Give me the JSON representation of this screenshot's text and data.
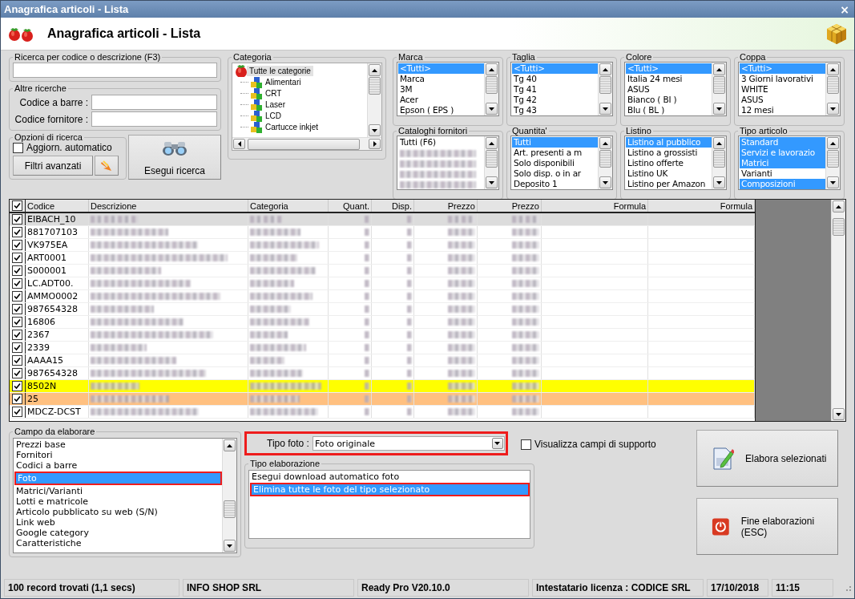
{
  "window": {
    "title": "Anagrafica articoli  - Lista",
    "close": "×"
  },
  "header": {
    "title": "Anagrafica articoli  - Lista"
  },
  "search": {
    "label": "Ricerca per codice o descrizione (F3)"
  },
  "other_searches": {
    "label": "Altre ricerche",
    "fields": [
      {
        "label": "Codice a barre :"
      },
      {
        "label": "Codice fornitore :"
      }
    ]
  },
  "search_options": {
    "label": "Opzioni di ricerca",
    "auto_update": {
      "label": "Aggiorn. automatico",
      "checked": false
    },
    "advanced_button": "Filtri avanzati"
  },
  "run_search_button": "Esegui ricerca",
  "category": {
    "label": "Categoria",
    "tree": [
      {
        "text": "Tutte le categorie",
        "selected": true,
        "children": [
          {
            "text": "Alimentari",
            "selected": false
          },
          {
            "text": "CRT",
            "selected": false
          },
          {
            "text": "Laser",
            "selected": false
          },
          {
            "text": "LCD",
            "selected": false
          },
          {
            "text": "Cartucce inkjet",
            "selected": false
          }
        ]
      }
    ]
  },
  "filters": [
    {
      "label": "Marca",
      "items": [
        {
          "text": "<Tutti>",
          "selected": true
        },
        {
          "text": "Marca",
          "selected": false
        },
        {
          "text": "3M",
          "selected": false
        },
        {
          "text": "Acer",
          "selected": false
        },
        {
          "text": "Epson ( EPS )",
          "selected": false
        }
      ]
    },
    {
      "label": "Taglia",
      "items": [
        {
          "text": "<Tutti>",
          "selected": true
        },
        {
          "text": "Tg 40",
          "selected": false
        },
        {
          "text": "Tg 41",
          "selected": false
        },
        {
          "text": "Tg 42",
          "selected": false
        },
        {
          "text": "Tg 43",
          "selected": false
        }
      ]
    },
    {
      "label": "Colore",
      "items": [
        {
          "text": "<Tutti>",
          "selected": true
        },
        {
          "text": "Italia 24 mesi",
          "selected": false
        },
        {
          "text": "ASUS",
          "selected": false
        },
        {
          "text": "Bianco ( BI )",
          "selected": false
        },
        {
          "text": "Blu ( BL )",
          "selected": false
        }
      ]
    },
    {
      "label": "Coppa",
      "items": [
        {
          "text": "<Tutti>",
          "selected": true
        },
        {
          "text": "3 Giorni lavorativi",
          "selected": false
        },
        {
          "text": "WHITE",
          "selected": false
        },
        {
          "text": "ASUS",
          "selected": false
        },
        {
          "text": "12 mesi",
          "selected": false
        }
      ]
    },
    {
      "label": "Cataloghi fornitori",
      "items": [
        {
          "kind": "text",
          "text": "Tutti (F6)",
          "selected": false
        },
        {
          "kind": "blurred",
          "selected": false
        },
        {
          "kind": "blurred",
          "selected": false
        },
        {
          "kind": "blurred",
          "selected": false
        },
        {
          "kind": "blurred",
          "selected": false
        }
      ]
    },
    {
      "label": "Quantita'",
      "items": [
        {
          "text": "Tutti",
          "selected": true
        },
        {
          "text": "Art. presenti a m",
          "selected": false
        },
        {
          "text": "Solo disponibili",
          "selected": false
        },
        {
          "text": "Solo disp. o in ar",
          "selected": false
        },
        {
          "text": "Deposito 1",
          "selected": false
        }
      ]
    },
    {
      "label": "Listino",
      "items": [
        {
          "text": "Listino al pubblico",
          "selected": true
        },
        {
          "text": "Listino a grossisti",
          "selected": false
        },
        {
          "text": "Listino offerte",
          "selected": false
        },
        {
          "text": "Listino UK",
          "selected": false
        },
        {
          "text": "Listino per Amazon",
          "selected": false
        }
      ]
    },
    {
      "label": "Tipo articolo",
      "items": [
        {
          "text": "Standard",
          "selected": true
        },
        {
          "text": "Servizi e lavorazio",
          "selected": true
        },
        {
          "text": "Matrici",
          "selected": true
        },
        {
          "text": "Varianti",
          "selected": false
        },
        {
          "text": "Composizioni",
          "selected": true
        }
      ]
    }
  ],
  "table": {
    "columns": [
      {
        "kind": "check",
        "checked": true
      },
      {
        "kind": "text",
        "label": "Codice"
      },
      {
        "kind": "text",
        "label": "Descrizione"
      },
      {
        "kind": "text",
        "label": "Categoria"
      },
      {
        "kind": "number",
        "label": "Quant."
      },
      {
        "kind": "number",
        "label": "Disp."
      },
      {
        "kind": "number",
        "label": "Prezzo"
      },
      {
        "kind": "number",
        "label": "Prezzo"
      },
      {
        "kind": "number",
        "label": "Formula"
      },
      {
        "kind": "number",
        "label": "Formula"
      }
    ],
    "rows": [
      {
        "code": "EIBACH_10",
        "checked": true,
        "selected": true
      },
      {
        "code": "881707103",
        "checked": true,
        "selected": false
      },
      {
        "code": "VK975EA",
        "checked": true,
        "selected": false
      },
      {
        "code": "ART0001",
        "checked": true,
        "selected": false
      },
      {
        "code": "S000001",
        "checked": true,
        "selected": false
      },
      {
        "code": "LC.ADT00.",
        "checked": true,
        "selected": false
      },
      {
        "code": "AMMO0002",
        "checked": true,
        "selected": false
      },
      {
        "code": "987654328",
        "checked": true,
        "selected": false
      },
      {
        "code": "16806",
        "checked": true,
        "selected": false
      },
      {
        "code": "2367",
        "checked": true,
        "selected": false
      },
      {
        "code": "2339",
        "checked": true,
        "selected": false
      },
      {
        "code": "AAAA15",
        "checked": true,
        "selected": false
      },
      {
        "code": "987654328",
        "checked": true,
        "selected": false
      },
      {
        "code": "8502N",
        "checked": true,
        "selected": false,
        "color": "#ffff00"
      },
      {
        "code": "25",
        "checked": true,
        "selected": false,
        "color": "#ffc080"
      },
      {
        "code": "MDCZ-DCST",
        "checked": true,
        "selected": false
      }
    ]
  },
  "process_field": {
    "label": "Campo da elaborare",
    "items": [
      {
        "text": "Prezzi base",
        "selected": false,
        "highlighted": false
      },
      {
        "text": "Fornitori",
        "selected": false,
        "highlighted": false
      },
      {
        "text": "Codici a barre",
        "selected": false,
        "highlighted": false
      },
      {
        "text": "Foto",
        "selected": true,
        "highlighted": true
      },
      {
        "text": "Matrici/Varianti",
        "selected": false,
        "highlighted": false
      },
      {
        "text": "Lotti e matricole",
        "selected": false,
        "highlighted": false
      },
      {
        "text": "Articolo pubblicato su web (S/N)",
        "selected": false,
        "highlighted": false
      },
      {
        "text": "Link web",
        "selected": false,
        "highlighted": false
      },
      {
        "text": "Google category",
        "selected": false,
        "highlighted": false
      },
      {
        "text": "Caratteristiche",
        "selected": false,
        "highlighted": false
      }
    ]
  },
  "photo_type": {
    "label": "Tipo foto :",
    "value": "Foto originale",
    "highlighted": true
  },
  "support_fields": {
    "label": "Visualizza campi di supporto",
    "checked": false
  },
  "process_type": {
    "label": "Tipo elaborazione",
    "items": [
      {
        "text": "Esegui download automatico foto",
        "selected": false,
        "highlighted": false
      },
      {
        "text": "Elimina tutte le foto del tipo selezionato",
        "selected": true,
        "highlighted": true
      }
    ]
  },
  "actions": [
    {
      "kind": "edit",
      "label": "Elabora selezionati"
    },
    {
      "kind": "exit",
      "label": "Fine elaborazioni (ESC)"
    }
  ],
  "status_bar": [
    "100 record trovati (1,1 secs)",
    "INFO SHOP SRL",
    "Ready Pro V20.10.0",
    "Intestatario licenza : CODICE SRL",
    "17/10/2018",
    "11:15"
  ]
}
